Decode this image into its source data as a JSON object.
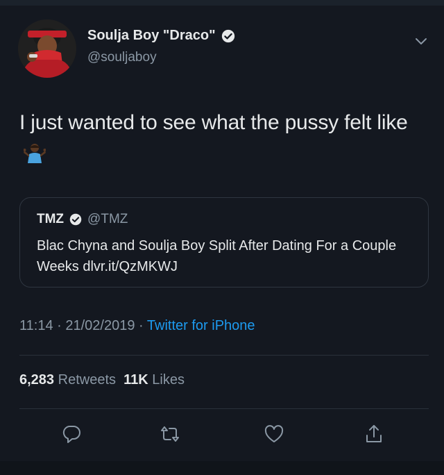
{
  "author": {
    "name": "Soulja Boy \"Draco\"",
    "handle": "@souljaboy"
  },
  "tweet": {
    "text": "I just wanted to see what the pussy felt like"
  },
  "quoted": {
    "name": "TMZ",
    "handle": "@TMZ",
    "text": "Blac Chyna and Soulja Boy Split After Dating For a Couple Weeks dlvr.it/QzMKWJ"
  },
  "meta": {
    "time": "11:14",
    "date": "21/02/2019",
    "separator": "·",
    "app": "Twitter for iPhone"
  },
  "stats": {
    "retweets_count": "6,283",
    "retweets_label": "Retweets",
    "likes_count": "11K",
    "likes_label": "Likes"
  },
  "icons": {
    "verified": "verified-badge-icon",
    "menu": "chevron-down-icon",
    "reply": "reply-icon",
    "retweet": "retweet-icon",
    "like": "heart-icon",
    "share": "share-icon",
    "emoji": "person-shrugging-emoji"
  },
  "colors": {
    "background": "#141820",
    "text": "#e7e9ea",
    "muted": "#8b98a5",
    "accent": "#1d9bf0"
  }
}
